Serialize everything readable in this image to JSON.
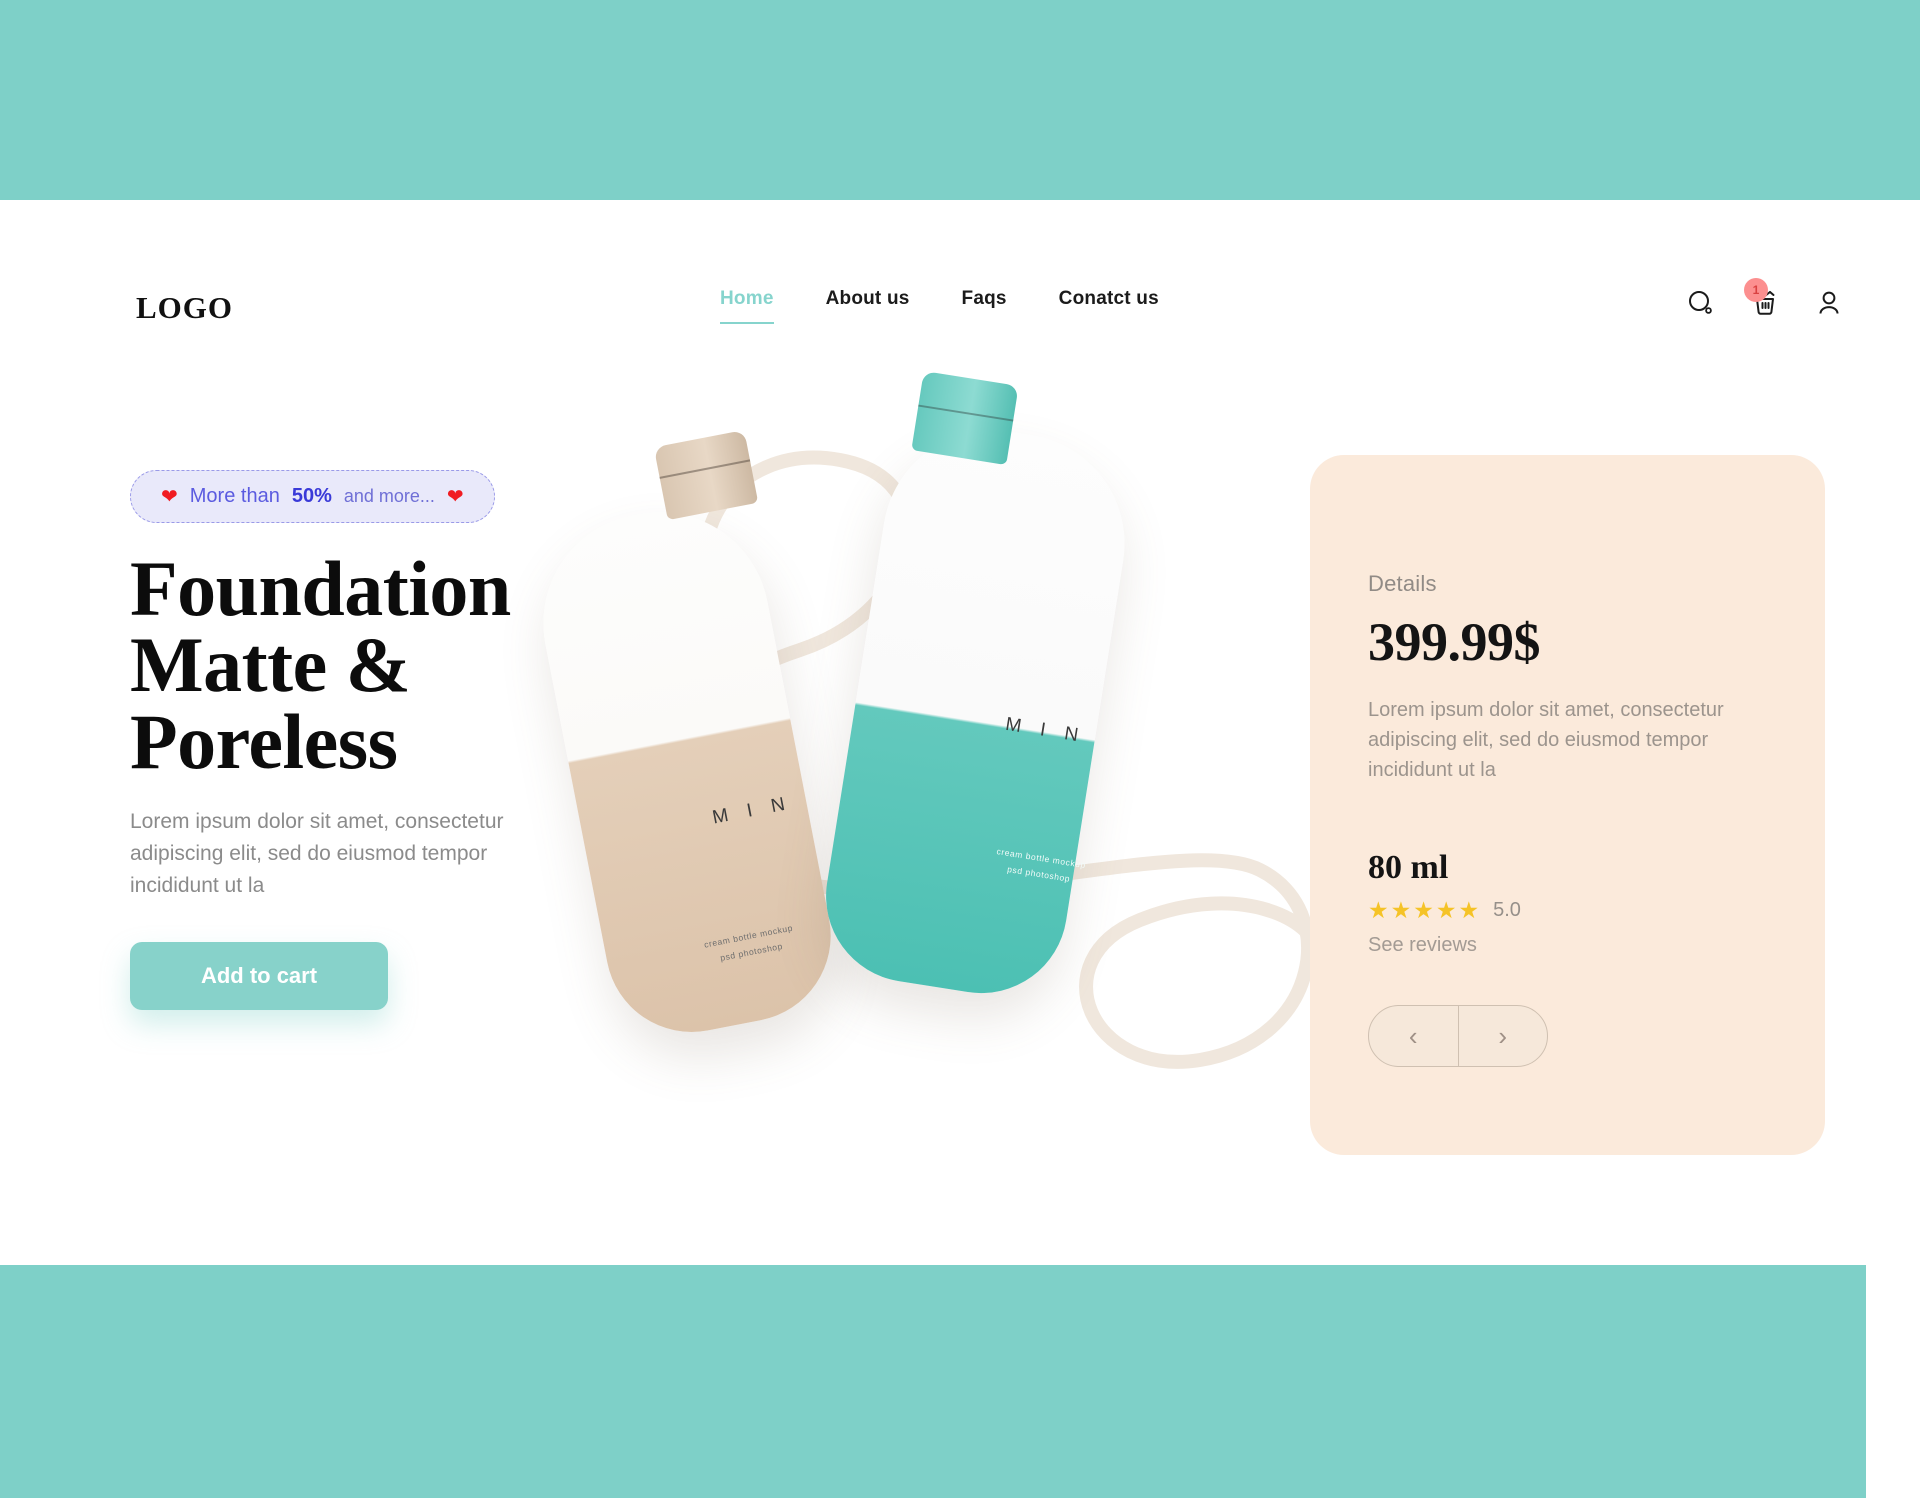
{
  "theme": {
    "accent_teal": "#7ed0c8",
    "button_teal": "#87d2ca",
    "card_cream": "#fbeadb",
    "promo_bg": "#e9e9fa",
    "promo_text": "#5b5be0",
    "star_gold": "#f5c327",
    "badge_red": "#fc8f8f"
  },
  "header": {
    "logo": "LOGO",
    "nav": [
      {
        "label": "Home",
        "active": true
      },
      {
        "label": "About us",
        "active": false
      },
      {
        "label": "Faqs",
        "active": false
      },
      {
        "label": "Conatct us",
        "active": false
      }
    ],
    "icons": {
      "search": "search-icon",
      "cart": "cart-icon",
      "account": "user-icon"
    },
    "cart_count": "1"
  },
  "hero": {
    "promo": {
      "heart_left": "❤",
      "prefix": "More than ",
      "highlight": "50%",
      "suffix": " and more...",
      "heart_right": "❤"
    },
    "headline_line1": "Foundation",
    "headline_line2": "Matte &",
    "headline_line3": "Poreless",
    "paragraph": "Lorem ipsum dolor sit amet, consectetur adipiscing elit, sed do eiusmod tempor incididunt ut la",
    "cta_label": "Add to cart"
  },
  "product": {
    "brand_mark": "M I N",
    "mockup_line1": "cream bottle mockup",
    "mockup_line2": "psd photoshop"
  },
  "details": {
    "label": "Details",
    "price": "399.99$",
    "description": "Lorem ipsum dolor sit amet, consectetur adipiscing elit, sed do eiusmod tempor incididunt ut la",
    "volume": "80 ml",
    "stars": "★★★★★",
    "rating_value": "5.0",
    "reviews_link": "See reviews",
    "prev_arrow": "‹",
    "next_arrow": "›"
  }
}
